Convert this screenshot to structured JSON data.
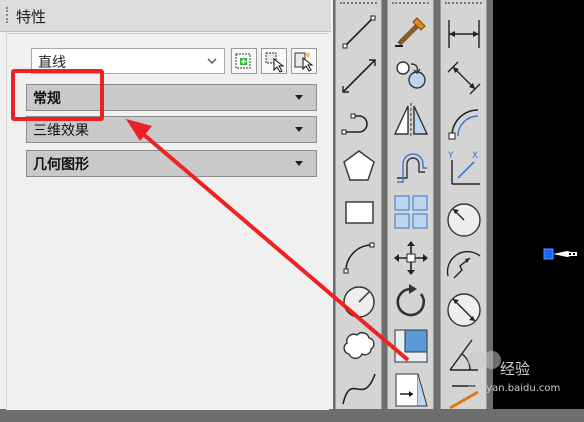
{
  "properties_panel": {
    "title": "特性",
    "object_type": "直线",
    "sections": [
      {
        "label": "常规"
      },
      {
        "label": "三维效果"
      },
      {
        "label": "几何图形"
      }
    ]
  },
  "watermark": {
    "text": "经验",
    "url": "jingyan.baidu.com"
  },
  "colors": {
    "highlight": "#ee2222",
    "viewport": "#000000",
    "grip": "#1565ff"
  },
  "toolbar_1": [
    "line-tool-icon",
    "construction-line-icon",
    "polyline-icon",
    "polygon-icon",
    "rectangle-icon",
    "arc-icon",
    "circle-icon",
    "revision-cloud-icon",
    "spline-icon"
  ],
  "toolbar_2": [
    "match-properties-icon",
    "copy-icon",
    "mirror-icon",
    "offset-icon",
    "array-icon",
    "move-icon",
    "rotate-icon",
    "scale-icon",
    "stretch-icon"
  ],
  "toolbar_3": [
    "linear-dimension-icon",
    "aligned-dimension-icon",
    "arc-length-icon",
    "ordinate-dimension-icon",
    "radius-dimension-icon",
    "jogged-dimension-icon",
    "diameter-dimension-icon",
    "angular-dimension-icon",
    "quick-dimension-icon"
  ]
}
